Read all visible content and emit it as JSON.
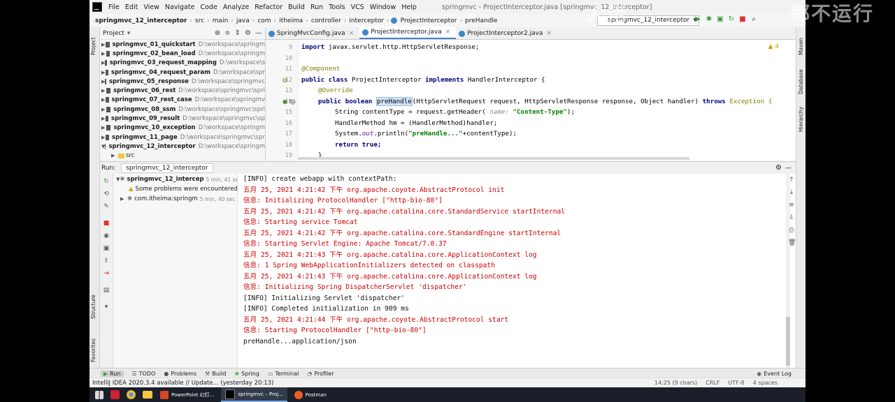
{
  "watermarks": {
    "top_mid": "大佬",
    "top_right": "都不运行"
  },
  "window_title": "springmvc - ProjectInterceptor.java [springmvc_12_interceptor]",
  "menu": [
    "File",
    "Edit",
    "View",
    "Navigate",
    "Code",
    "Analyze",
    "Refactor",
    "Build",
    "Run",
    "Tools",
    "VCS",
    "Window",
    "Help"
  ],
  "breadcrumb": [
    "springmvc_12_interceptor",
    "src",
    "main",
    "java",
    "com",
    "itheima",
    "controller",
    "interceptor",
    "ProjectInterceptor",
    "preHandle"
  ],
  "run_config": "springmvc_12_interceptor",
  "project_panel": {
    "title": "Project",
    "items": [
      {
        "name": "springmvc_01_quickstart",
        "path": "D:\\workspace\\springm"
      },
      {
        "name": "springmvc_02_bean_load",
        "path": "D:\\workspace\\springm"
      },
      {
        "name": "springmvc_03_request_mapping",
        "path": "D:\\workspace\\s"
      },
      {
        "name": "springmvc_04_request_param",
        "path": "D:\\workspace\\spr"
      },
      {
        "name": "springmvc_05_response",
        "path": "D:\\workspace\\springmvc"
      },
      {
        "name": "springmvc_06_rest",
        "path": "D:\\workspace\\springmvc\\spri"
      },
      {
        "name": "springmvc_07_rest_case",
        "path": "D:\\workspace\\springmv"
      },
      {
        "name": "springmvc_08_ssm",
        "path": "D:\\workspace\\springmvc\\spri"
      },
      {
        "name": "springmvc_09_result",
        "path": "D:\\workspace\\springmvc\\sp"
      },
      {
        "name": "springmvc_10_exception",
        "path": "D:\\workspace\\springm"
      },
      {
        "name": "springmvc_11_page",
        "path": "D:\\workspace\\springmvc\\spr"
      },
      {
        "name": "springmvc_12_interceptor",
        "path": "D:\\workspace\\springm"
      }
    ],
    "sub": "src"
  },
  "tabs": [
    {
      "label": "SpringMvcConfig.java"
    },
    {
      "label": "ProjectInterceptor.java"
    },
    {
      "label": "ProjectInterceptor2.java"
    }
  ],
  "editor": {
    "line_numbers": [
      "9",
      "10",
      "11",
      "12",
      "13",
      "14",
      "15",
      "16",
      "17",
      "18",
      "19"
    ],
    "warning_count": "4",
    "lines": {
      "l9a": "import ",
      "l9b": "javax.servlet.http.HttpServletResponse;",
      "l11": "@Component",
      "l12a": "public class ",
      "l12b": "ProjectInterceptor ",
      "l12c": "implements ",
      "l12d": "HandlerInterceptor {",
      "l13": "@Override",
      "l14a": "public boolean ",
      "l14b": "preHandle",
      "l14c": "(HttpServletRequest request, HttpServletResponse response, Object handler) ",
      "l14d": "throws ",
      "l14e": "Exception {",
      "l15a": "String contentType = request.getHeader( ",
      "l15b": "name: ",
      "l15c": "\"Content-Type\"",
      "l15d": ");",
      "l16": "HandlerMethod hm = (HandlerMethod)handler;",
      "l17a": "System.",
      "l17b": "out",
      "l17c": ".println(",
      "l17d": "\"preHandle...\"",
      "l17e": "+contentType);",
      "l18a": "return ",
      "l18b": "true;",
      "l19": "}"
    }
  },
  "run": {
    "label": "Run:",
    "tab": "springmvc_12_interceptor",
    "tree": [
      {
        "label": "springmvc_12_intercep",
        "time": "5 min, 41 sec"
      },
      {
        "label": "Some problems were encountered",
        "time": ""
      },
      {
        "label": "com.itheima:springm",
        "time": "5 min, 40 sec"
      }
    ],
    "console": [
      "[INFO] create webapp with contextPath:",
      "五月 25, 2021 4:21:42 下午 org.apache.coyote.AbstractProtocol init",
      "信息: Initializing ProtocolHandler [\"http-bio-80\"]",
      "五月 25, 2021 4:21:42 下午 org.apache.catalina.core.StandardService startInternal",
      "信息: Starting service Tomcat",
      "五月 25, 2021 4:21:42 下午 org.apache.catalina.core.StandardEngine startInternal",
      "信息: Starting Servlet Engine: Apache Tomcat/7.0.37",
      "五月 25, 2021 4:21:43 下午 org.apache.catalina.core.ApplicationContext log",
      "信息: 1 Spring WebApplicationInitializers detected on classpath",
      "五月 25, 2021 4:21:43 下午 org.apache.catalina.core.ApplicationContext log",
      "信息: Initializing Spring DispatcherServlet 'dispatcher'",
      "[INFO] Initializing Servlet 'dispatcher'",
      "[INFO] Completed initialization in 909 ms",
      "五月 25, 2021 4:21:44 下午 org.apache.coyote.AbstractProtocol start",
      "信息: Starting ProtocolHandler [\"http-bio-80\"]",
      "preHandle...application/json"
    ]
  },
  "bottom_tabs": [
    "Run",
    "TODO",
    "Problems",
    "Build",
    "Spring",
    "Terminal",
    "Profiler"
  ],
  "event_log": "Event Log",
  "status": {
    "message": "IntelliJ IDEA 2020.3.4 available // Update... (yesterday 20:13)",
    "position": "14:25 (9 chars)",
    "line_sep": "CRLF",
    "encoding": "UTF-8",
    "indent": "4 spaces"
  },
  "side_labels": {
    "left": [
      "Project",
      "Structure",
      "Favorites"
    ],
    "right": [
      "Maven",
      "Database",
      "Hierarchy"
    ]
  },
  "taskbar": [
    {
      "label": "PowerPoint 幻灯...",
      "color": "#d24726"
    },
    {
      "label": "springmvc – Proj...",
      "color": "#000000"
    },
    {
      "label": "Postman",
      "color": "#ef5b25"
    }
  ]
}
